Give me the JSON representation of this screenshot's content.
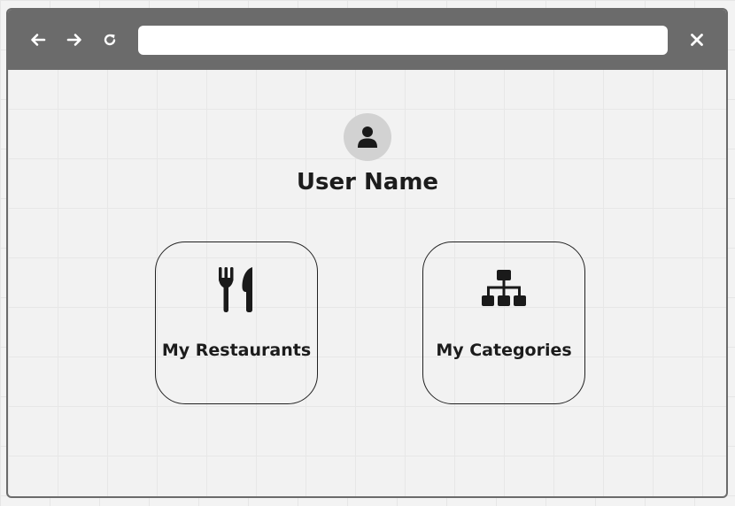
{
  "browser": {
    "back_icon": "arrow-left-icon",
    "forward_icon": "arrow-right-icon",
    "reload_icon": "reload-icon",
    "close_icon": "close-icon",
    "address_value": "",
    "chrome_color": "#6b6b6b"
  },
  "profile": {
    "avatar_icon": "user-icon",
    "user_name": "User Name"
  },
  "cards": [
    {
      "label": "My Restaurants",
      "icon": "utensils-icon"
    },
    {
      "label": "My Categories",
      "icon": "sitemap-icon"
    }
  ]
}
